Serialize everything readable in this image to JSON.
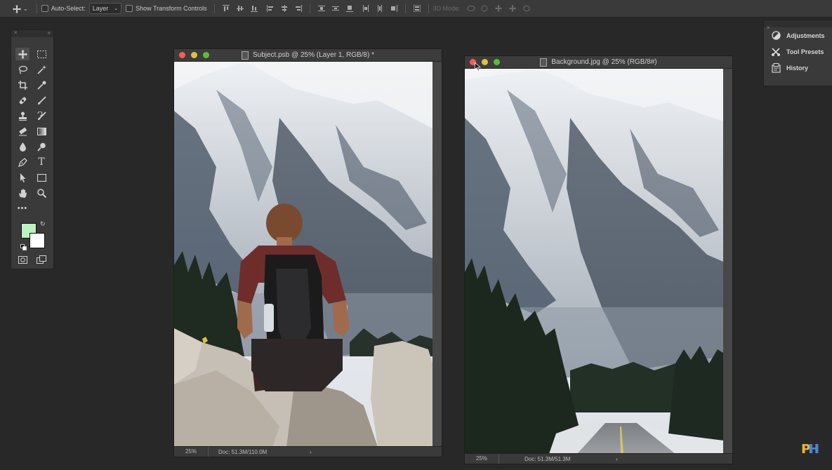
{
  "options_bar": {
    "auto_select_label": "Auto-Select:",
    "auto_select_value": "Layer",
    "show_transform_label": "Show Transform Controls",
    "mode_3d_label": "3D Mode:"
  },
  "tools": [
    "move-tool-icon",
    "marquee-tool-icon",
    "lasso-tool-icon",
    "magic-wand-tool-icon",
    "crop-tool-icon",
    "eyedropper-tool-icon",
    "healing-brush-tool-icon",
    "brush-tool-icon",
    "clone-stamp-tool-icon",
    "history-brush-tool-icon",
    "eraser-tool-icon",
    "gradient-tool-icon",
    "blur-tool-icon",
    "dodge-tool-icon",
    "pen-tool-icon",
    "type-tool-icon",
    "path-selection-tool-icon",
    "rectangle-tool-icon",
    "hand-tool-icon",
    "zoom-tool-icon"
  ],
  "colors": {
    "foreground": "#b9f3bd",
    "background": "#ffffff",
    "ui_dark": "#282828",
    "panel": "#3a3a3a"
  },
  "right_panel": {
    "items": [
      {
        "label": "Adjustments",
        "icon": "adjustments-icon"
      },
      {
        "label": "Tool Presets",
        "icon": "tool-presets-icon"
      },
      {
        "label": "History",
        "icon": "history-icon"
      }
    ]
  },
  "doc1": {
    "title": "Subject.psb @ 25% (Layer 1, RGB/8) *",
    "zoom": "25%",
    "doc_size": "Doc: 51.3M/110.0M",
    "arrow": "›"
  },
  "doc2": {
    "title": "Background.jpg @ 25% (RGB/8#)",
    "zoom": "25%",
    "doc_size": "Doc: 51.3M/51.3M",
    "arrow": "›"
  },
  "watermark": {
    "p": "P",
    "h": "H"
  }
}
